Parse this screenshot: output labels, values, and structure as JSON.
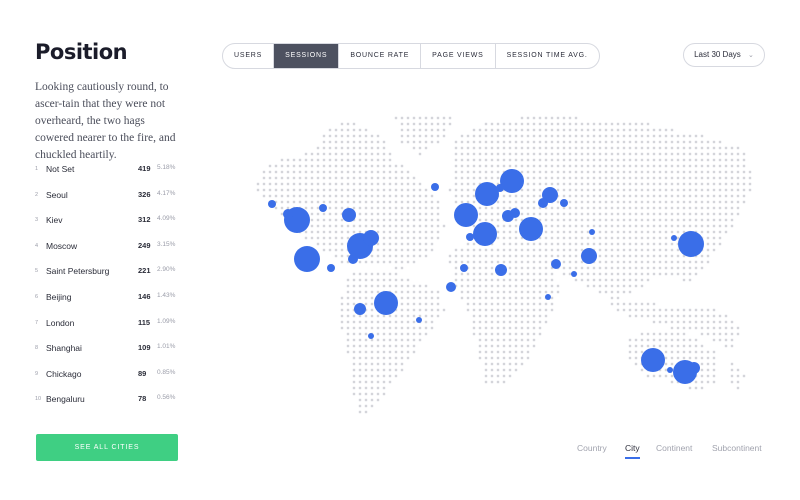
{
  "page": {
    "title": "Position",
    "description": "Looking cautiously round, to ascer-tain that they were not overheard, the two hags cowered nearer to the fire, and chuckled heartily."
  },
  "tabs": [
    {
      "label": "USERS",
      "active": false
    },
    {
      "label": "SESSIONS",
      "active": true
    },
    {
      "label": "BOUNCE RATE",
      "active": false
    },
    {
      "label": "PAGE VIEWS",
      "active": false
    },
    {
      "label": "SESSION TIME AVG.",
      "active": false
    }
  ],
  "date_range": {
    "selected": "Last 30 Days"
  },
  "cities": [
    {
      "rank": "1",
      "name": "Not Set",
      "count": "419",
      "pct": "5.18%"
    },
    {
      "rank": "2",
      "name": "Seoul",
      "count": "326",
      "pct": "4.17%"
    },
    {
      "rank": "3",
      "name": "Kiev",
      "count": "312",
      "pct": "4.09%"
    },
    {
      "rank": "4",
      "name": "Moscow",
      "count": "249",
      "pct": "3.15%"
    },
    {
      "rank": "5",
      "name": "Saint Petersburg",
      "count": "221",
      "pct": "2.90%"
    },
    {
      "rank": "6",
      "name": "Beijing",
      "count": "146",
      "pct": "1.43%"
    },
    {
      "rank": "7",
      "name": "London",
      "count": "115",
      "pct": "1.09%"
    },
    {
      "rank": "8",
      "name": "Shanghai",
      "count": "109",
      "pct": "1.01%"
    },
    {
      "rank": "9",
      "name": "Chickago",
      "count": "89",
      "pct": "0.85%"
    },
    {
      "rank": "10",
      "name": "Bengaluru",
      "count": "78",
      "pct": "0.56%"
    }
  ],
  "see_all_label": "SEE ALL CITIES",
  "geo_tabs": [
    {
      "label": "Country",
      "active": false
    },
    {
      "label": "City",
      "active": true
    },
    {
      "label": "Continent",
      "active": false
    },
    {
      "label": "Subcontinent",
      "active": false
    }
  ],
  "colors": {
    "accent": "#3a6ee8",
    "button": "#3fcf83",
    "map_dot": "#d4d5da",
    "active_tab": "#4d5160"
  },
  "icons": {
    "date_dropdown": "chevron-down-icon"
  }
}
